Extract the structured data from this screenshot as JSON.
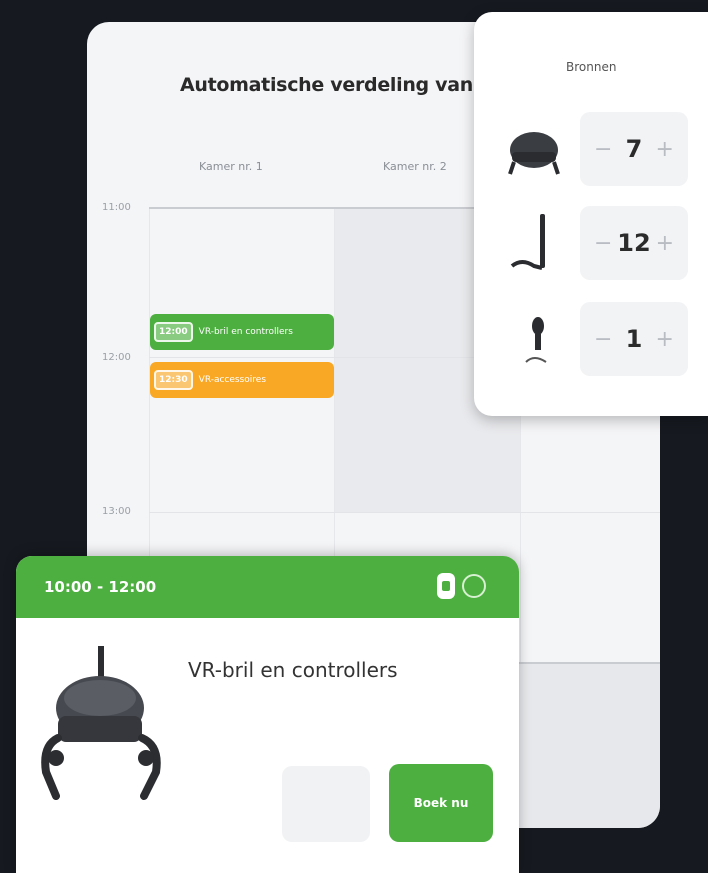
{
  "calendar": {
    "title": "Automatische verdeling van",
    "rooms": [
      "Kamer nr. 1",
      "Kamer nr. 2"
    ],
    "times": [
      "11:00",
      "12:00",
      "13:00"
    ],
    "events": [
      {
        "time": "12:00",
        "label": "VR-bril en controllers",
        "color": "#4caf3f"
      },
      {
        "time": "12:30",
        "label": "VR-accessoires",
        "color": "#f9a825"
      }
    ]
  },
  "resources": {
    "title": "Bronnen",
    "items": [
      {
        "icon": "vr-headset-icon",
        "value": "7",
        "minus": "−",
        "plus": "+"
      },
      {
        "icon": "vr-controller-icon",
        "value": "12",
        "minus": "−",
        "plus": "+"
      },
      {
        "icon": "vr-accessory-icon",
        "value": "1",
        "minus": "−",
        "plus": "+"
      }
    ]
  },
  "booking": {
    "time_range": "10:00 - 12:00",
    "name": "VR-bril en controllers",
    "book_label": "Boek nu",
    "accent": "#4caf3f"
  }
}
